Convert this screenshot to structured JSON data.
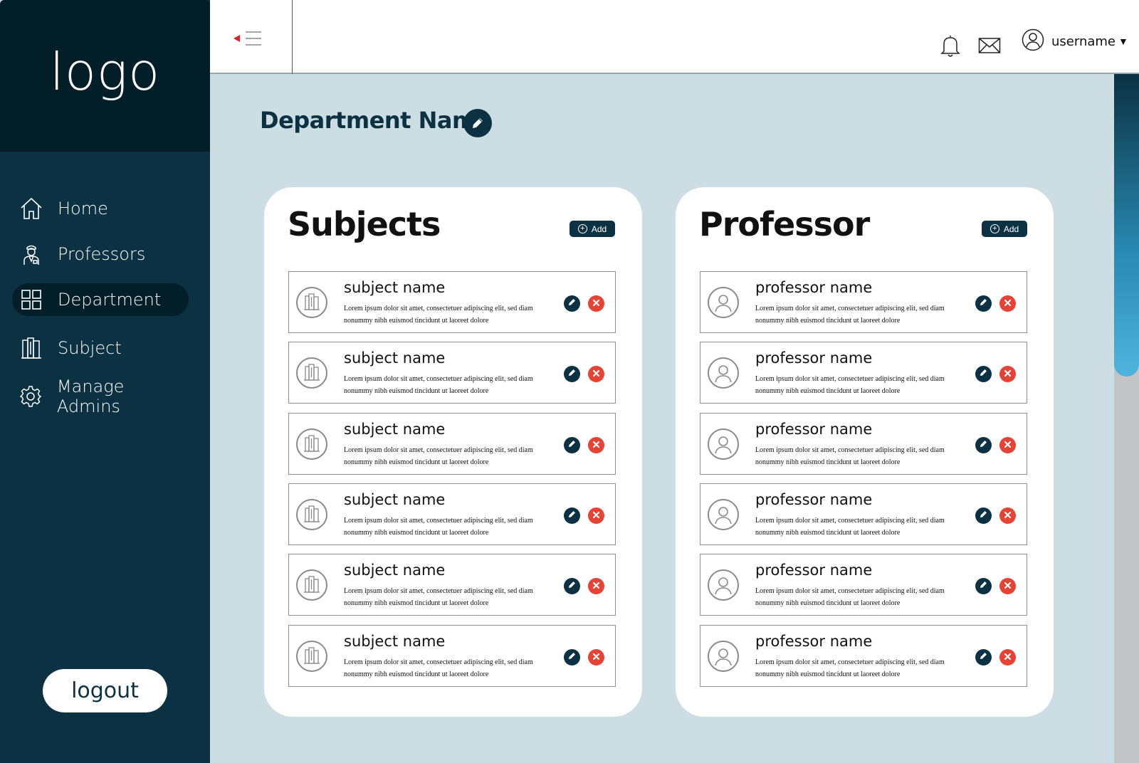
{
  "sidebar": {
    "logo": "logo",
    "items": [
      {
        "label": "Home",
        "icon": "home-icon",
        "active": false
      },
      {
        "label": "Professors",
        "icon": "professor-icon",
        "active": false
      },
      {
        "label": "Department",
        "icon": "grid-icon",
        "active": true
      },
      {
        "label": "Subject",
        "icon": "books-icon",
        "active": false
      },
      {
        "label": "Manage Admins",
        "icon": "gear-icon",
        "active": false
      }
    ],
    "logout_label": "logout"
  },
  "header": {
    "username": "username",
    "icons": [
      "menu-toggle-icon",
      "bell-icon",
      "mail-icon",
      "user-icon"
    ]
  },
  "department": {
    "title": "Department Name"
  },
  "subjects": {
    "title": "Subjects",
    "add_label": "Add",
    "items": [
      {
        "name": "subject name",
        "desc": "Lorem ipsum dolor sit amet, consectetuer adipiscing elit, sed diam nonummy nibh euismod tincidunt ut laoreet dolore"
      },
      {
        "name": "subject name",
        "desc": "Lorem ipsum dolor sit amet, consectetuer adipiscing elit, sed diam nonummy nibh euismod tincidunt ut laoreet dolore"
      },
      {
        "name": "subject name",
        "desc": "Lorem ipsum dolor sit amet, consectetuer adipiscing elit, sed diam nonummy nibh euismod tincidunt ut laoreet dolore"
      },
      {
        "name": "subject name",
        "desc": "Lorem ipsum dolor sit amet, consectetuer adipiscing elit, sed diam nonummy nibh euismod tincidunt ut laoreet dolore"
      },
      {
        "name": "subject name",
        "desc": "Lorem ipsum dolor sit amet, consectetuer adipiscing elit, sed diam nonummy nibh euismod tincidunt ut laoreet dolore"
      },
      {
        "name": "subject name",
        "desc": "Lorem ipsum dolor sit amet, consectetuer adipiscing elit, sed diam nonummy nibh euismod tincidunt ut laoreet dolore"
      }
    ]
  },
  "professors": {
    "title": "Professor",
    "add_label": "Add",
    "items": [
      {
        "name": "professor name",
        "desc": "Lorem ipsum dolor sit amet, consectetuer adipiscing elit, sed diam nonummy nibh euismod tincidunt ut laoreet dolore"
      },
      {
        "name": "professor name",
        "desc": "Lorem ipsum dolor sit amet, consectetuer adipiscing elit, sed diam nonummy nibh euismod tincidunt ut laoreet dolore"
      },
      {
        "name": "professor name",
        "desc": "Lorem ipsum dolor sit amet, consectetuer adipiscing elit, sed diam nonummy nibh euismod tincidunt ut laoreet dolore"
      },
      {
        "name": "professor name",
        "desc": "Lorem ipsum dolor sit amet, consectetuer adipiscing elit, sed diam nonummy nibh euismod tincidunt ut laoreet dolore"
      },
      {
        "name": "professor name",
        "desc": "Lorem ipsum dolor sit amet, consectetuer adipiscing elit, sed diam nonummy nibh euismod tincidunt ut laoreet dolore"
      },
      {
        "name": "professor name",
        "desc": "Lorem ipsum dolor sit amet, consectetuer adipiscing elit, sed diam nonummy nibh euismod tincidunt ut laoreet dolore"
      }
    ]
  },
  "colors": {
    "sidebar": "#0b3142",
    "sidebar_dark": "#021e29",
    "background": "#ccdde3",
    "accent": "#0b3142",
    "delete": "#e44336"
  }
}
